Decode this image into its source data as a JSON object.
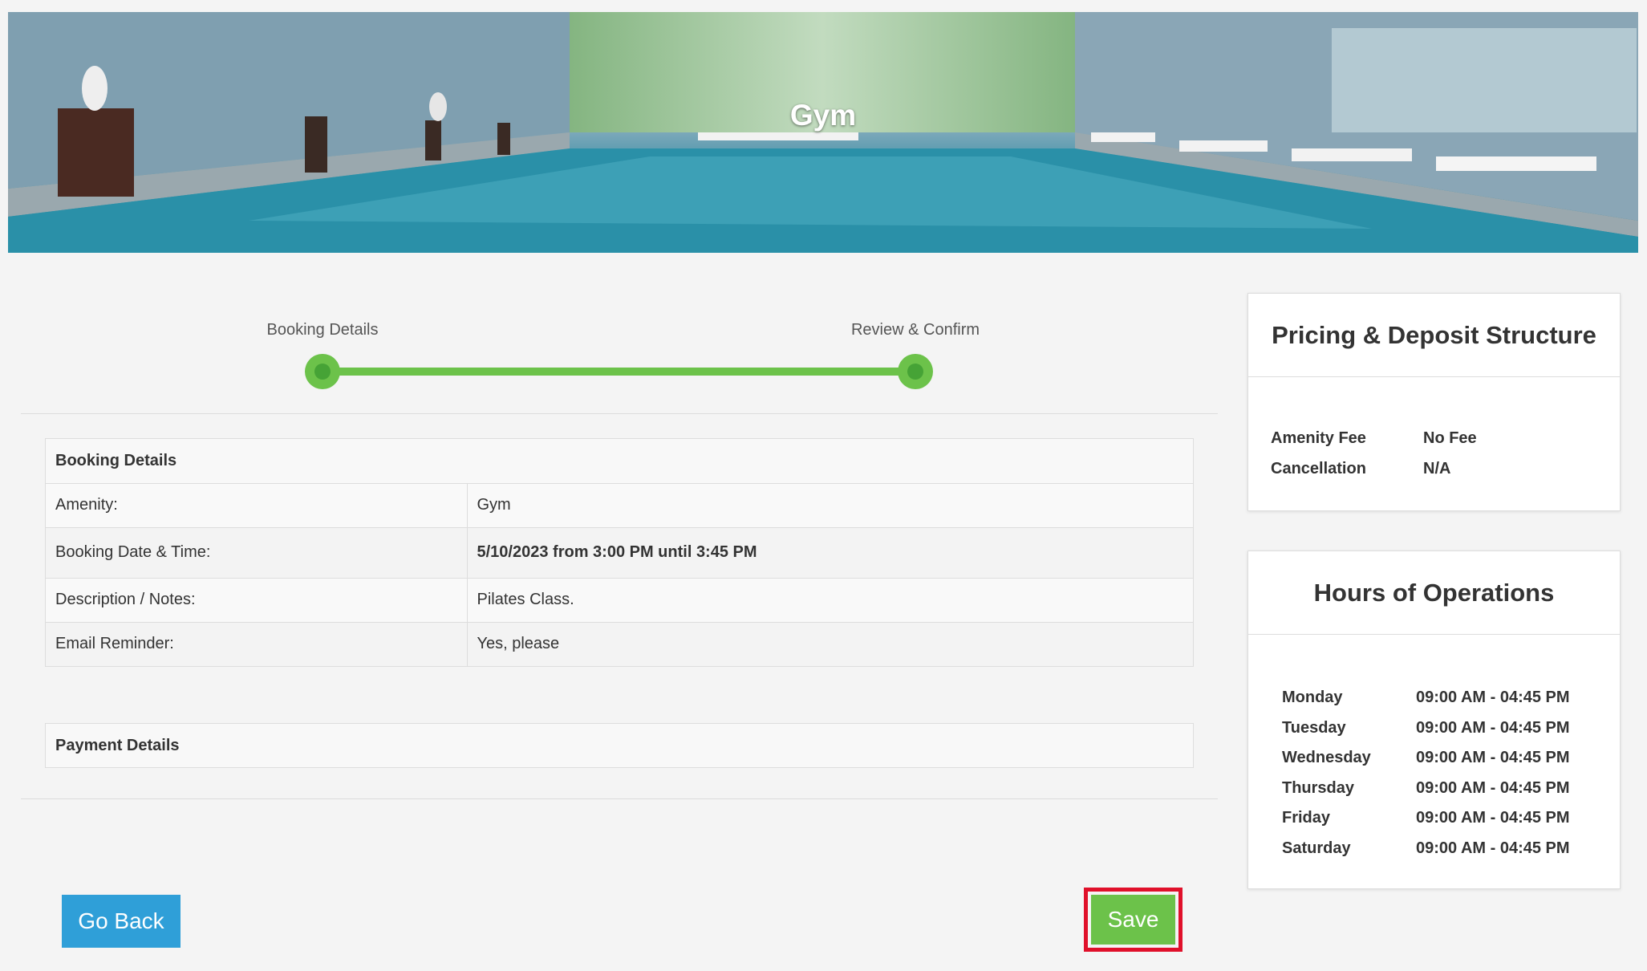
{
  "hero": {
    "title": "Gym"
  },
  "stepper": {
    "steps": [
      {
        "label": "Booking Details"
      },
      {
        "label": "Review & Confirm"
      }
    ]
  },
  "booking": {
    "header": "Booking Details",
    "rows": [
      {
        "label": "Amenity:",
        "value": "Gym"
      },
      {
        "label": "Booking Date & Time:",
        "value": "5/10/2023 from 3:00 PM until 3:45 PM"
      },
      {
        "label": "Description / Notes:",
        "value": "Pilates Class."
      },
      {
        "label": "Email Reminder:",
        "value": "Yes, please"
      }
    ]
  },
  "payment": {
    "header": "Payment Details"
  },
  "actions": {
    "back_label": "Go Back",
    "save_label": "Save"
  },
  "pricing": {
    "title": "Pricing & Deposit Structure",
    "items": [
      {
        "key": "Amenity Fee",
        "value": "No Fee"
      },
      {
        "key": "Cancellation",
        "value": "N/A"
      }
    ]
  },
  "hours": {
    "title": "Hours of Operations",
    "items": [
      {
        "day": "Monday",
        "time": "09:00 AM - 04:45 PM"
      },
      {
        "day": "Tuesday",
        "time": "09:00 AM - 04:45 PM"
      },
      {
        "day": "Wednesday",
        "time": "09:00 AM - 04:45 PM"
      },
      {
        "day": "Thursday",
        "time": "09:00 AM - 04:45 PM"
      },
      {
        "day": "Friday",
        "time": "09:00 AM - 04:45 PM"
      },
      {
        "day": "Saturday",
        "time": "09:00 AM - 04:45 PM"
      }
    ]
  },
  "colors": {
    "accent_green": "#6cc24a",
    "button_blue": "#2f9fd8",
    "highlight_red": "#e0102a"
  }
}
